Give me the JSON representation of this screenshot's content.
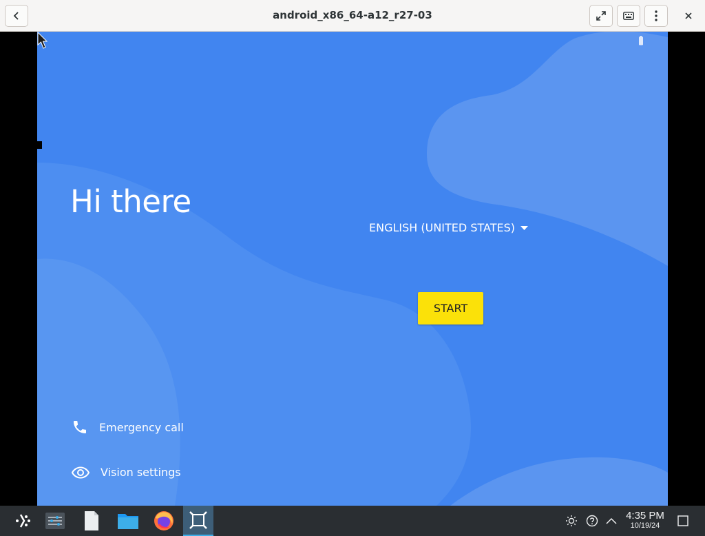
{
  "window": {
    "title": "android_x86_64-a12_r27-03",
    "back_icon": "chevron-left-icon",
    "fullscreen_icon": "expand-icon",
    "keyboard_icon": "keyboard-icon",
    "menu_icon": "kebab-menu-icon",
    "close_icon": "close-icon"
  },
  "android": {
    "greeting": "Hi there",
    "language": "ENGLISH (UNITED STATES)",
    "start_label": "START",
    "emergency_label": "Emergency call",
    "vision_label": "Vision settings",
    "background_color": "#4185f0",
    "accent_color": "#fbe109"
  },
  "taskbar": {
    "apps": [
      "launcher-icon",
      "settings-icon",
      "document-icon",
      "folder-icon",
      "firefox-icon",
      "emulator-icon"
    ],
    "clock_time": "4:35 PM",
    "clock_date": "10/19/24"
  }
}
